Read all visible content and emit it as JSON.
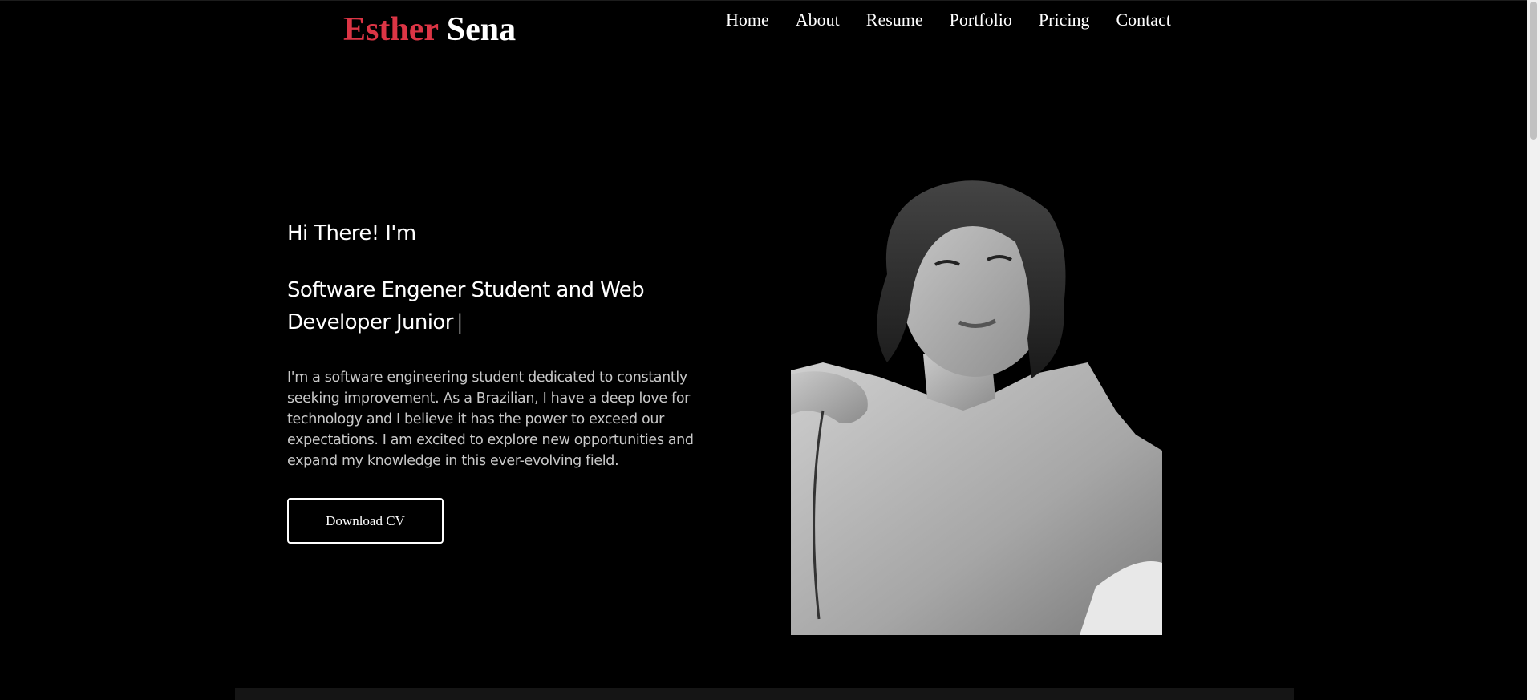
{
  "header": {
    "logo_first": "Esther",
    "logo_last": "Sena",
    "nav": [
      {
        "label": "Home"
      },
      {
        "label": "About"
      },
      {
        "label": "Resume"
      },
      {
        "label": "Portfolio"
      },
      {
        "label": "Pricing"
      },
      {
        "label": "Contact"
      }
    ]
  },
  "hero": {
    "greeting": "Hi There! I'm",
    "headline": "Software Engener Student and Web Developer Junior",
    "cursor": "|",
    "bio": "I'm a software engineering student dedicated to constantly seeking improvement. As a Brazilian, I have a deep love for technology and I believe it has the power to exceed our expectations. I am excited to explore new opportunities and expand my knowledge in this ever-evolving field.",
    "cv_button": "Download CV"
  },
  "colors": {
    "accent": "#dc3545",
    "background": "#000000",
    "text": "#ffffff"
  }
}
